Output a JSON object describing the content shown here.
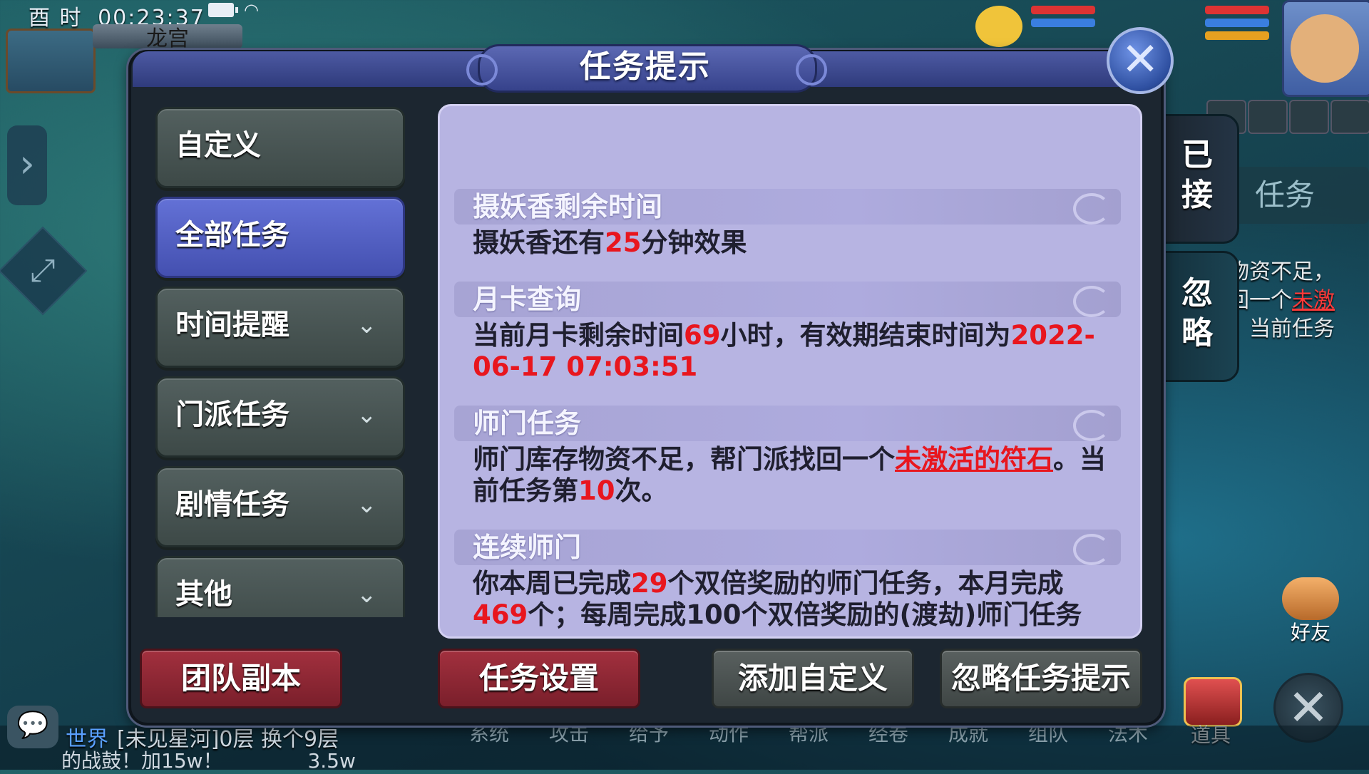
{
  "hud": {
    "time_label": "酉 时",
    "clock": "00:23:37",
    "location": "龙宫"
  },
  "dialog": {
    "title": "任务提示",
    "close_icon": "close-icon"
  },
  "categories": [
    {
      "label": "自定义",
      "active": false,
      "expandable": false
    },
    {
      "label": "全部任务",
      "active": true,
      "expandable": false
    },
    {
      "label": "时间提醒",
      "active": false,
      "expandable": true
    },
    {
      "label": "门派任务",
      "active": false,
      "expandable": true
    },
    {
      "label": "剧情任务",
      "active": false,
      "expandable": true
    },
    {
      "label": "其他",
      "active": false,
      "expandable": true
    }
  ],
  "sections": [
    {
      "title": "摄妖香剩余时间",
      "body": {
        "p1": "摄妖香还有",
        "v1": "25",
        "p2": "分钟效果"
      }
    },
    {
      "title": "月卡查询",
      "body": {
        "p1": "当前月卡剩余时间",
        "v1": "69",
        "p2": "小时，有效期结束时间为",
        "v2": "2022-06-17 07:03:51"
      }
    },
    {
      "title": "师门任务",
      "body": {
        "p1": "师门库存物资不足，帮门派找回一个",
        "link": "未激活的符石",
        "p2": "。当前任务第",
        "v1": "10",
        "p3": "次。"
      }
    },
    {
      "title": "连续师门",
      "body": {
        "p1": "你本周已完成",
        "v1": "29",
        "p2": "个双倍奖励的师门任务，本月完成",
        "v2": "469",
        "p3": "个；每周完成100个双倍奖励的(渡劫)师门任务"
      }
    }
  ],
  "footer": {
    "team_dungeon": "团队副本",
    "task_settings": "任务设置",
    "add_custom": "添加自定义",
    "ignore_hint": "忽略任务提示"
  },
  "side_tabs": {
    "accepted": "已接",
    "ignored": "忽略"
  },
  "background": {
    "task_tab": "任务",
    "task_text_1": "物资不足，",
    "task_text_2": "回一个",
    "task_text_link": "未激",
    "task_text_3": "。当前任务",
    "friends": "好友",
    "items": "道具",
    "chat_channel": "世界",
    "chat_msg_1": "[未见星河]0层 换个9层",
    "chat_msg_2": "的战鼓！加15w！",
    "chat_msg_3": "3.5w",
    "menu": [
      "系统",
      "攻击",
      "给予",
      "动作",
      "帮派",
      "经卷",
      "成就",
      "组队",
      "法术"
    ]
  },
  "colors": {
    "accent_blue": "#4450b0",
    "panel_bg": "#b7b4e2",
    "highlight_red": "#e8161e",
    "footer_red": "#7a1f2b"
  }
}
